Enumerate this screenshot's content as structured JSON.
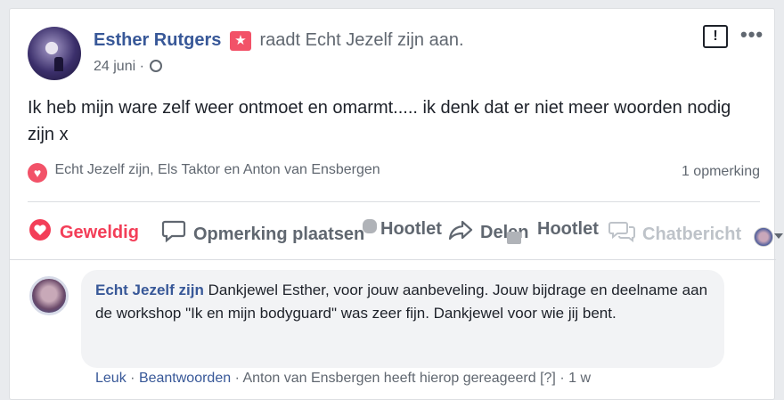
{
  "post": {
    "author": "Esther Rutgers",
    "badge_icon": "star-review-icon",
    "action_text": "raadt Echt Jezelf zijn aan.",
    "date": "24 juni",
    "separator": "·",
    "privacy_icon": "globe-icon",
    "text": "Ik heb mijn ware zelf weer ontmoet en omarmt..... ik denk dat er niet meer woorden nodig zijn x",
    "reactions_text": "Echt Jezelf zijn, Els Taktor en Anton van Ensbergen",
    "comment_count": "1 opmerking",
    "report_label": "!",
    "more_label": "•••"
  },
  "action_bar": {
    "like": "Geweldig",
    "comment": "Opmerking plaatsen",
    "hootlet1": "Hootlet",
    "share": "Delen",
    "hootlet2": "Hootlet",
    "chat": "Chatbericht"
  },
  "comment": {
    "author": "Echt Jezelf zijn",
    "text": "Dankjewel Esther, voor jouw aanbeveling. Jouw bijdrage en deelname aan de workshop \"Ik en mijn bodyguard\" was zeer fijn. Dankjewel voor wie jij bent.",
    "like": "Leuk",
    "reply": "Beantwoorden",
    "reacted_note": "Anton van Ensbergen heeft hierop gereageerd",
    "help": "[?]",
    "time": "1 w",
    "sep": "·"
  },
  "colors": {
    "link_blue": "#385898",
    "love_red": "#f33e58",
    "muted": "#606770"
  }
}
